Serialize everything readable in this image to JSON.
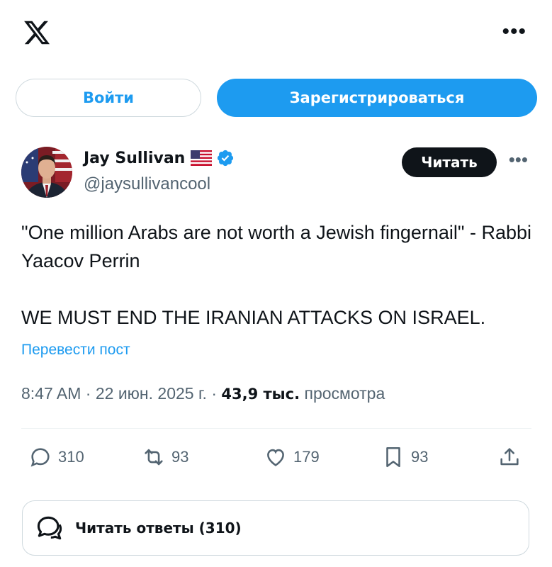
{
  "header": {
    "logo_icon": "x-logo-icon",
    "more_icon": "more-horizontal-icon"
  },
  "auth": {
    "login_label": "Войти",
    "signup_label": "Зарегистрироваться",
    "accent_color": "#1d9bf0"
  },
  "tweet": {
    "author": {
      "name": "Jay Sullivan",
      "flag_icon": "us-flag-icon",
      "verified_icon": "verified-badge-icon",
      "handle": "@jaysullivancool"
    },
    "follow_label": "Читать",
    "text_line1": "\"One million Arabs are not worth a Jewish fingernail\" - Rabbi Yaacov Perrin",
    "text_line2": "WE MUST END THE IRANIAN ATTACKS ON ISRAEL.",
    "translate_label": "Перевести пост",
    "time": "8:47 AM",
    "separator": "·",
    "date": "22 июн. 2025 г.",
    "views_count": "43,9 тыс.",
    "views_label": "просмотра"
  },
  "actions": {
    "replies": "310",
    "reposts": "93",
    "likes": "179",
    "bookmarks": "93"
  },
  "replies_button": {
    "label": "Читать ответы (310)"
  }
}
